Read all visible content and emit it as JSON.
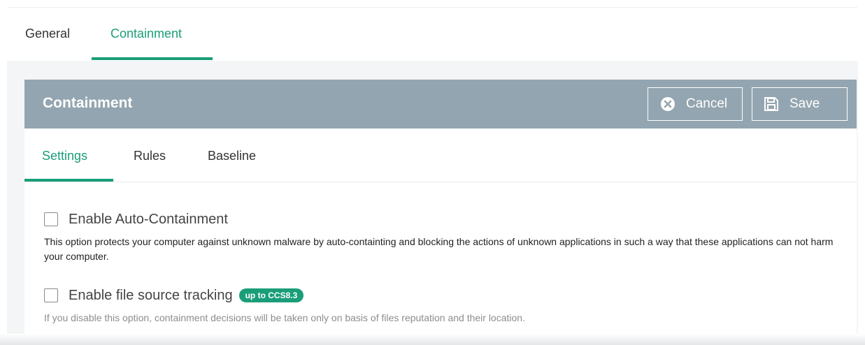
{
  "top_tabs": [
    {
      "label": "General"
    },
    {
      "label": "Containment"
    }
  ],
  "panel": {
    "title": "Containment",
    "cancel_label": "Cancel",
    "save_label": "Save"
  },
  "sub_tabs": [
    {
      "label": "Settings"
    },
    {
      "label": "Rules"
    },
    {
      "label": "Baseline"
    }
  ],
  "options": {
    "auto_containment": {
      "label": "Enable Auto-Containment",
      "checked": false,
      "description": "This option protects your computer against unknown malware by auto-containting and blocking the actions of unknown applications in such a way that these applications can not harm your computer."
    },
    "file_source_tracking": {
      "label": "Enable file source tracking",
      "badge": "up to CCS8.3",
      "checked": false,
      "description": "If you disable this option, containment decisions will be taken only on basis of files reputation and their location."
    }
  },
  "colors": {
    "accent": "#1a9e79",
    "header_bg": "#93a5b0"
  }
}
